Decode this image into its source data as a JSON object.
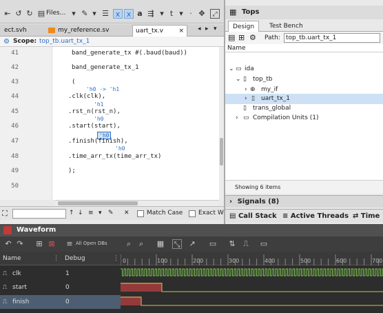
{
  "toolbar": {
    "files_label": "Files..."
  },
  "editor_tabs": [
    {
      "label": "ect.svh"
    },
    {
      "label": "my_reference.sv"
    },
    {
      "label": "uart_tx.v"
    }
  ],
  "scope": {
    "label": "Scope:",
    "value": "top_tb.uart_tx_1"
  },
  "code": {
    "line_numbers": [
      "41",
      "42",
      "43",
      "44",
      "45",
      "46",
      "47",
      "48",
      "49",
      "50"
    ],
    "lines": [
      "band_generate_tx #(.baud(baud))",
      "band_generate_tx_1",
      "(",
      ".clk(clk),",
      ".rst_n(rst_n),",
      ".start(start),",
      ".finish(finish),",
      ".time_arr_tx(time_arr_tx)",
      ");"
    ],
    "hints": [
      "'h0 -> 'h1",
      "'h1",
      "'h0",
      "'h0",
      "'h0"
    ]
  },
  "findbar": {
    "match_case": "Match Case",
    "exact": "Exact W"
  },
  "tops": {
    "title": "Tops",
    "tabs": [
      "Design",
      "Test Bench"
    ],
    "path_label": "Path:",
    "path_value": "top_tb.uart_tx_1",
    "name_header": "Name",
    "tree": [
      {
        "label": "ida"
      },
      {
        "label": "top_tb"
      },
      {
        "label": "my_if"
      },
      {
        "label": "uart_tx_1"
      },
      {
        "label": "trans_global"
      },
      {
        "label": "Compilation Units (1)"
      }
    ],
    "showing": "Showing 6 items"
  },
  "signals_label": "Signals (8)",
  "bottom_tabs": [
    "Call Stack",
    "Active Threads",
    "Time"
  ],
  "waveform": {
    "title": "Waveform",
    "db_select": "All Open DBs",
    "columns": [
      "Name",
      "Debug"
    ],
    "ticks": [
      "0",
      "100",
      "200",
      "300",
      "400",
      "500",
      "600",
      "700"
    ],
    "signals": [
      {
        "name": "clk",
        "value": "1"
      },
      {
        "name": "start",
        "value": "0"
      },
      {
        "name": "finish",
        "value": "0"
      }
    ]
  },
  "colors": {
    "accent_blue": "#2a6ec8",
    "waveform_bg": "#2d2d2d",
    "signal_green": "#7ec850",
    "signal_red": "#c04040",
    "selected_row": "#4e5e72"
  }
}
